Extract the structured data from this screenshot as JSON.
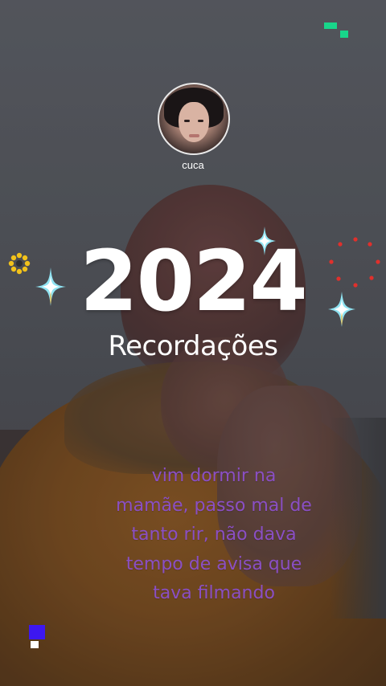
{
  "story": {
    "username": "cuca",
    "year": "2024",
    "subtitle": "Recordações",
    "caption_lines": [
      "vim dormir na",
      "mamãe, passo mal de",
      "tanto rir, não dava",
      "tempo de avisa que",
      "tava filmando"
    ]
  },
  "colors": {
    "caption": "#8a4fc4",
    "title": "#ffffff",
    "logo_top": "#18d68a",
    "logo_bottom": "#3d17f0",
    "flower": "#f2c21b",
    "dots": "#e0302c"
  },
  "icons": {
    "top_logo": "app-logo-icon",
    "bottom_logo": "brand-logo-icon",
    "decorations": [
      "sparkle-icon",
      "sparkle-icon",
      "sparkle-icon",
      "flower-icon",
      "dots-ring-icon"
    ]
  }
}
